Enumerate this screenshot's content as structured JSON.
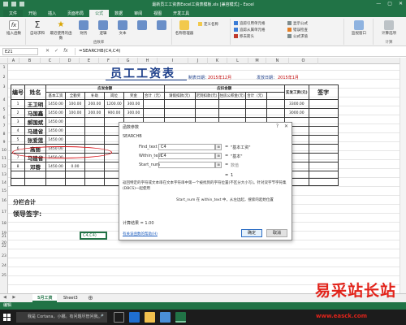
{
  "window": {
    "title": "最新员工工资表Excel工资表模板.xls [兼容模式] - Excel"
  },
  "ribbon": {
    "tabs": [
      "文件",
      "开始",
      "插入",
      "页面布局",
      "公式",
      "数据",
      "审阅",
      "视图",
      "开发工具"
    ],
    "active_tab": "公式",
    "groups": {
      "insert_function": "插入函数",
      "autosum": "自动求和",
      "recent": "最近使用的函数",
      "financial": "财务",
      "logical": "逻辑",
      "text": "文本",
      "library_label": "函数库",
      "name_manager": "名称管理器",
      "define_name": "定义名称",
      "trace_precedents": "追踪引用单元格",
      "trace_dependents": "追踪从属单元格",
      "remove_arrows": "移去箭头",
      "show_formulas": "显示公式",
      "error_check": "错误检查",
      "evaluate": "公式求值",
      "watch": "监视窗口",
      "calc_options": "计算选项",
      "calc_label": "计算"
    }
  },
  "formula_bar": {
    "name_box": "E21",
    "cancel": "✕",
    "enter": "✓",
    "fx": "fx",
    "formula": "=SEARCHB(C4,C4)"
  },
  "columns": [
    "A",
    "B",
    "C",
    "D",
    "E",
    "F",
    "G",
    "H",
    "I",
    "J",
    "K",
    "L",
    "M",
    "N",
    "O"
  ],
  "rows": [
    "1",
    "2",
    "3",
    "4",
    "5",
    "6",
    "7",
    "8",
    "9",
    "10",
    "11",
    "12",
    "13",
    "14",
    "15",
    "16",
    "17",
    "18",
    "19",
    "20",
    "21",
    "22",
    "23",
    "24",
    "25"
  ],
  "sheet": {
    "title": "员工工资表",
    "date_label_1": "制表日期：",
    "date_val_1": "2015年12月",
    "date_label_2": "发放日期：",
    "date_val_2": "2015年1月",
    "headers": {
      "number": "编号",
      "name": "姓名",
      "payable_group": "应发金额",
      "deduct_group": "应扣金额",
      "actual": "实发工资(元)",
      "signature": "签字",
      "base": "基本工资",
      "bonus": "全勤奖",
      "subsidy": "补助",
      "allowance": "岗位",
      "award": "奖金",
      "subtotal": "合计（元）",
      "leave": "请假扣款(元)",
      "late": "迟到扣款(元)",
      "housing": "住房公积金(元)",
      "deduct_total": "合计（元）"
    },
    "employees": [
      {
        "id": "1",
        "name": "王卫明",
        "base": "1450.00",
        "bonus": "100.00",
        "subsidy": "200.00",
        "allowance": "1200.00",
        "award": "300.00",
        "actual": "3300.00"
      },
      {
        "id": "2",
        "name": "马国鑫",
        "base": "1450.00",
        "bonus": "100.00",
        "subsidy": "200.00",
        "allowance": "900.00",
        "award": "300.00",
        "actual": "3000.00"
      },
      {
        "id": "3",
        "name": "郝国斌",
        "base": "1450.00",
        "bonus": "",
        "subsidy": "",
        "allowance": "",
        "award": "",
        "actual": ""
      },
      {
        "id": "4",
        "name": "马建省",
        "base": "1450.00",
        "bonus": "",
        "subsidy": "",
        "allowance": "",
        "award": "",
        "actual": ""
      },
      {
        "id": "5",
        "name": "张爱莲",
        "base": "1450.00",
        "bonus": "",
        "subsidy": "",
        "allowance": "",
        "award": "",
        "actual": ""
      },
      {
        "id": "6",
        "name": "高丽",
        "base": "1450.00",
        "bonus": "",
        "subsidy": "",
        "allowance": "",
        "award": "",
        "actual": ""
      },
      {
        "id": "7",
        "name": "马建省",
        "base": "1450.00",
        "bonus": "",
        "subsidy": "",
        "allowance": "",
        "award": "",
        "actual": ""
      },
      {
        "id": "8",
        "name": "邓蓉",
        "base": "1450.00",
        "bonus": "0.00",
        "subsidy": "",
        "allowance": "",
        "award": "",
        "actual": ""
      }
    ],
    "subtotal": "分栏合计",
    "leader_sign": "领导签字:",
    "sign_partial": "出",
    "active_cell_text": "C4,C4)"
  },
  "dialog": {
    "title": "函数参数",
    "help": "?",
    "close": "✕",
    "function_name": "SEARCHB",
    "args": [
      {
        "label": "Find_text",
        "value": "C4",
        "result": "\"基本工资\""
      },
      {
        "label": "Within_text",
        "value": "C4",
        "result": "\"基本\""
      },
      {
        "label": "Start_num",
        "value": "",
        "result": "数值"
      }
    ],
    "equals": "=",
    "result_one": "1",
    "description": "返回特定的字符或文本串在文本字符串中第一个被找到的字符位置(不区分大小写)。针对双字节字符集(DBCS)一起使用",
    "arg_description": "Start_num   在 within_text 中，从左边起，搜索的起始位置",
    "calc_result": "计算结果 =   1.00",
    "help_link": "有关该函数的帮助(H)",
    "ok": "确定",
    "cancel": "取消"
  },
  "sheet_tabs": [
    "5月工资",
    "Sheet3"
  ],
  "active_sheet": "5月工资",
  "status": "编辑",
  "taskbar": {
    "search_placeholder": "我是 Cortana，小娜。有问题尽管问我。"
  },
  "watermark": {
    "text": "易采站长站",
    "url": "www.easck.com"
  },
  "colors": {
    "excel_green": "#217346",
    "highlight_red": "#d9141a",
    "title_blue": "#1d3f8a"
  }
}
